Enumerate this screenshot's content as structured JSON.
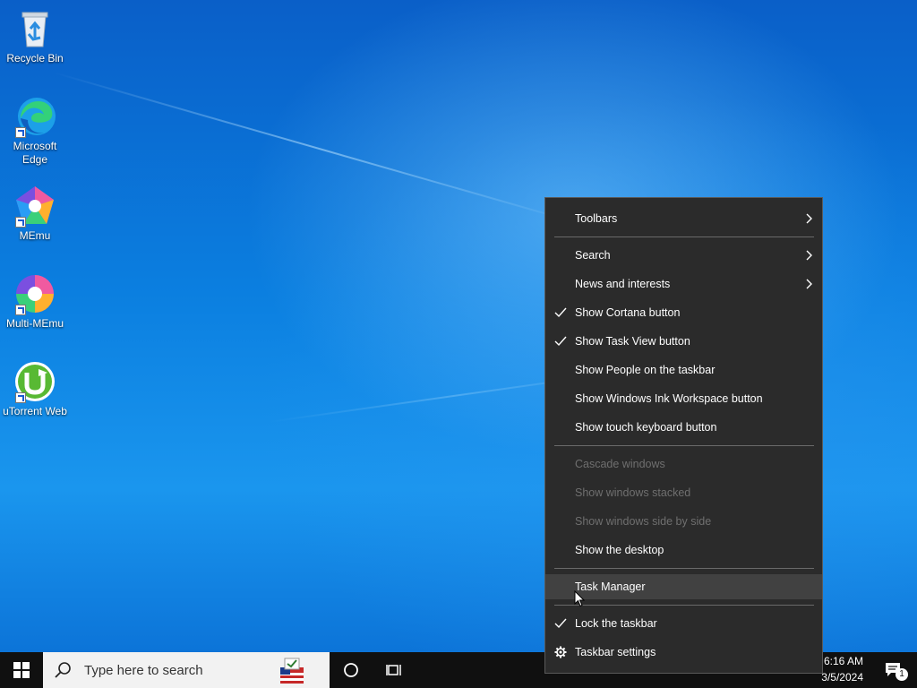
{
  "desktop": {
    "icons": [
      {
        "label": "Recycle Bin",
        "icon": "recycle-bin-icon"
      },
      {
        "label": "Microsoft Edge",
        "icon": "edge-icon"
      },
      {
        "label": "MEmu",
        "icon": "memu-icon"
      },
      {
        "label": "Multi-MEmu",
        "icon": "multi-memu-icon"
      },
      {
        "label": "uTorrent Web",
        "icon": "utorrent-icon"
      }
    ]
  },
  "context_menu": {
    "items": [
      {
        "label": "Toolbars",
        "checked": false,
        "submenu": true,
        "disabled": false
      },
      {
        "label": "Search",
        "checked": false,
        "submenu": true,
        "disabled": false
      },
      {
        "label": "News and interests",
        "checked": false,
        "submenu": true,
        "disabled": false
      },
      {
        "label": "Show Cortana button",
        "checked": true,
        "submenu": false,
        "disabled": false
      },
      {
        "label": "Show Task View button",
        "checked": true,
        "submenu": false,
        "disabled": false
      },
      {
        "label": "Show People on the taskbar",
        "checked": false,
        "submenu": false,
        "disabled": false
      },
      {
        "label": "Show Windows Ink Workspace button",
        "checked": false,
        "submenu": false,
        "disabled": false
      },
      {
        "label": "Show touch keyboard button",
        "checked": false,
        "submenu": false,
        "disabled": false
      },
      {
        "label": "Cascade windows",
        "checked": false,
        "submenu": false,
        "disabled": true
      },
      {
        "label": "Show windows stacked",
        "checked": false,
        "submenu": false,
        "disabled": true
      },
      {
        "label": "Show windows side by side",
        "checked": false,
        "submenu": false,
        "disabled": true
      },
      {
        "label": "Show the desktop",
        "checked": false,
        "submenu": false,
        "disabled": false
      },
      {
        "label": "Task Manager",
        "checked": false,
        "submenu": false,
        "disabled": false,
        "highlighted": true
      },
      {
        "label": "Lock the taskbar",
        "checked": true,
        "submenu": false,
        "disabled": false
      },
      {
        "label": "Taskbar settings",
        "checked": false,
        "submenu": false,
        "disabled": false,
        "icon": "gear-icon"
      }
    ]
  },
  "taskbar": {
    "search_placeholder": "Type here to search",
    "clock_time": "6:16 AM",
    "clock_date": "3/5/2024",
    "notification_count": "1"
  },
  "colors": {
    "menu_bg": "#2b2b2b",
    "menu_hover": "#414141",
    "taskbar_bg": "#101010",
    "desktop_blue": "#0b7fe0"
  }
}
